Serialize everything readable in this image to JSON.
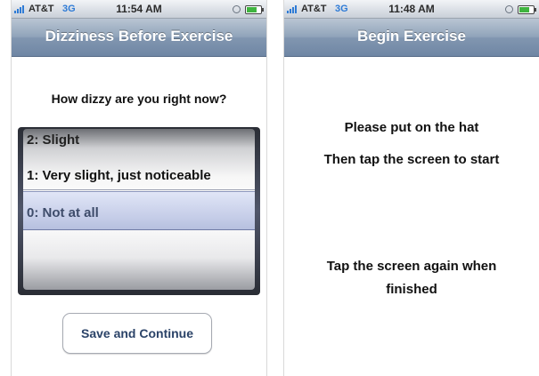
{
  "left_screen": {
    "status": {
      "carrier": "AT&T",
      "network": "3G",
      "time": "11:54 AM"
    },
    "nav_title": "Dizziness Before Exercise",
    "question": "How dizzy are you right now?",
    "picker": {
      "options": [
        "2: Slight",
        "1: Very slight, just noticeable",
        "0: Not at all"
      ],
      "selected_index": 2
    },
    "save_button": "Save and Continue"
  },
  "right_screen": {
    "status": {
      "carrier": "AT&T",
      "network": "3G",
      "time": "11:48 AM"
    },
    "nav_title": "Begin Exercise",
    "line1": "Please put on the hat",
    "line2": "Then tap the screen to start",
    "line3": "Tap the screen again when finished"
  },
  "colors": {
    "nav_bar": "#8196b0",
    "network_label": "#2e7bd6",
    "button_text": "#2b4368",
    "battery": "#3fb43f"
  },
  "icons": [
    "signal-bars-icon",
    "lock-rotation-icon",
    "battery-icon"
  ]
}
